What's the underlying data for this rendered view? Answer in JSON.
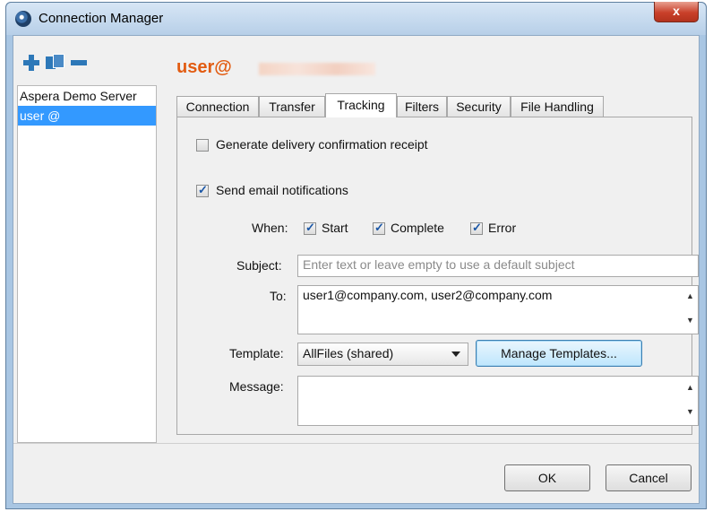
{
  "window": {
    "title": "Connection Manager",
    "close_glyph": "x"
  },
  "toolbar": {
    "add_icon": "plus-icon",
    "duplicate_icon": "duplicate-icon",
    "remove_icon": "minus-icon"
  },
  "servers": [
    {
      "label": "Aspera Demo Server",
      "selected": false
    },
    {
      "label": "user @",
      "selected": true
    }
  ],
  "host": {
    "title": "user@"
  },
  "tabs": [
    {
      "label": "Connection",
      "active": false
    },
    {
      "label": "Transfer",
      "active": false
    },
    {
      "label": "Tracking",
      "active": true
    },
    {
      "label": "Filters",
      "active": false
    },
    {
      "label": "Security",
      "active": false
    },
    {
      "label": "File Handling",
      "active": false
    }
  ],
  "tracking": {
    "delivery_receipt": {
      "label": "Generate delivery confirmation receipt",
      "checked": false
    },
    "email_notifications": {
      "label": "Send email notifications",
      "checked": true
    },
    "when_label": "When:",
    "when_options": [
      {
        "label": "Start",
        "checked": true
      },
      {
        "label": "Complete",
        "checked": true
      },
      {
        "label": "Error",
        "checked": true
      }
    ],
    "subject_label": "Subject:",
    "subject_value": "",
    "subject_placeholder": "Enter text or leave empty to use a default subject",
    "to_label": "To:",
    "to_value": "user1@company.com, user2@company.com",
    "template_label": "Template:",
    "template_value": "AllFiles (shared)",
    "manage_templates_label": "Manage Templates...",
    "message_label": "Message:",
    "message_value": ""
  },
  "footer": {
    "ok_label": "OK",
    "cancel_label": "Cancel"
  }
}
